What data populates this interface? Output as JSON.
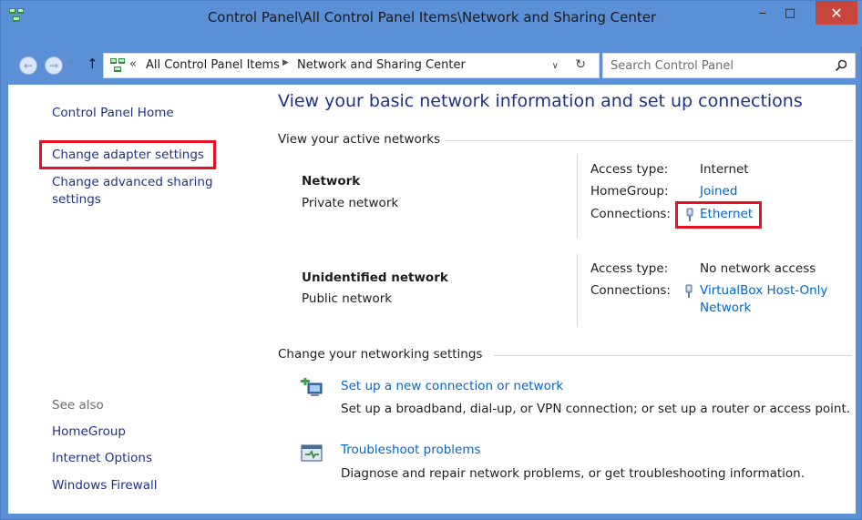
{
  "window": {
    "title": "Control Panel\\All Control Panel Items\\Network and Sharing Center",
    "minimize_symbol": "‒",
    "maximize_symbol": "□",
    "close_symbol": "✕"
  },
  "address": {
    "back_symbol": "←",
    "forward_symbol": "→",
    "recent_symbol": "▾",
    "up_symbol": "↑",
    "overflow_symbol": "«",
    "crumbs": [
      "All Control Panel Items",
      "Network and Sharing Center"
    ],
    "separator_symbol": "▶",
    "dropdown_symbol": "∨",
    "refresh_symbol": "↻"
  },
  "search": {
    "placeholder": "Search Control Panel"
  },
  "sidebar": {
    "home": "Control Panel Home",
    "links": [
      "Change adapter settings",
      "Change advanced sharing",
      "settings"
    ],
    "see_also_heading": "See also",
    "see_also": [
      "HomeGroup",
      "Internet Options",
      "Windows Firewall"
    ]
  },
  "main": {
    "title": "View your basic network information and set up connections",
    "active_heading": "View your active networks",
    "networks": [
      {
        "name": "Network",
        "type": "Private network",
        "access_label": "Access type:",
        "access_value": "Internet",
        "homegroup_label": "HomeGroup:",
        "homegroup_value": "Joined",
        "connections_label": "Connections:",
        "connection": "Ethernet"
      },
      {
        "name": "Unidentified network",
        "type": "Public network",
        "access_label": "Access type:",
        "access_value": "No network access",
        "connections_label": "Connections:",
        "connection_line1": "VirtualBox Host-Only",
        "connection_line2": "Network"
      }
    ],
    "settings_heading": "Change your networking settings",
    "tasks": [
      {
        "icon": "new-connection-icon",
        "link": "Set up a new connection or network",
        "desc": "Set up a broadband, dial-up, or VPN connection; or set up a router or access point."
      },
      {
        "icon": "troubleshoot-icon",
        "link": "Troubleshoot problems",
        "desc": "Diagnose and repair network problems, or get troubleshooting information."
      }
    ]
  },
  "colors": {
    "title_bar": "#5b8fd6",
    "close_button": "#c7453a",
    "link": "#0066cc",
    "nav_link": "#1e3287",
    "highlight": "#e81123"
  }
}
